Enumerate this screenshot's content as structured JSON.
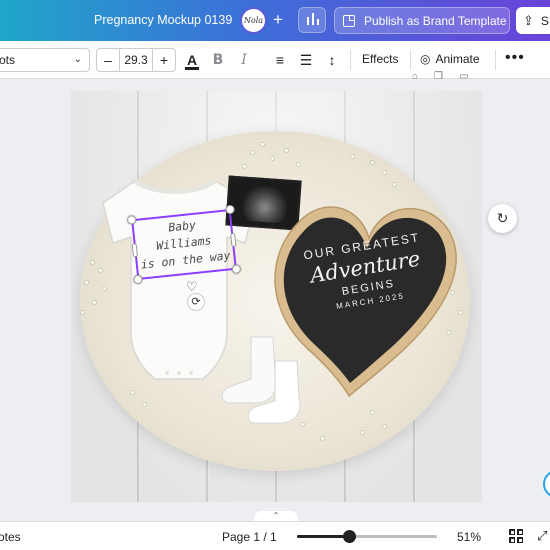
{
  "header": {
    "doc_title": "Pregnancy Mockup 0139",
    "avatar_text": "Nola",
    "add_label": "+",
    "publish_label": "Publish as Brand Template",
    "share_label": "S",
    "gradient_start": "#1fa6c9",
    "gradient_end": "#6a43d9"
  },
  "toolbar": {
    "font_name": "ots",
    "font_size": "29.3",
    "minus": "–",
    "plus": "+",
    "color_label": "A",
    "bold_label": "B",
    "italic_label": "I",
    "effects_label": "Effects",
    "animate_label": "Animate",
    "more_label": "•••"
  },
  "canvas": {
    "onesie_text": [
      "Baby",
      "Williams",
      "is on the way"
    ],
    "board_text": {
      "line1": "OUR GREATEST",
      "line2": "Adventure",
      "line3": "BEGINS",
      "line4": "MARCH 2025"
    },
    "selection_color": "#8b3dff",
    "heart_glyph": "♡",
    "rotate_glyph": "⟳",
    "comment_glyph": "↻"
  },
  "footer": {
    "notes_label": "otes",
    "page_info": "Page 1 / 1",
    "zoom_label": "51%",
    "zoom_fraction": 0.51,
    "expand_glyph": "⤢"
  }
}
